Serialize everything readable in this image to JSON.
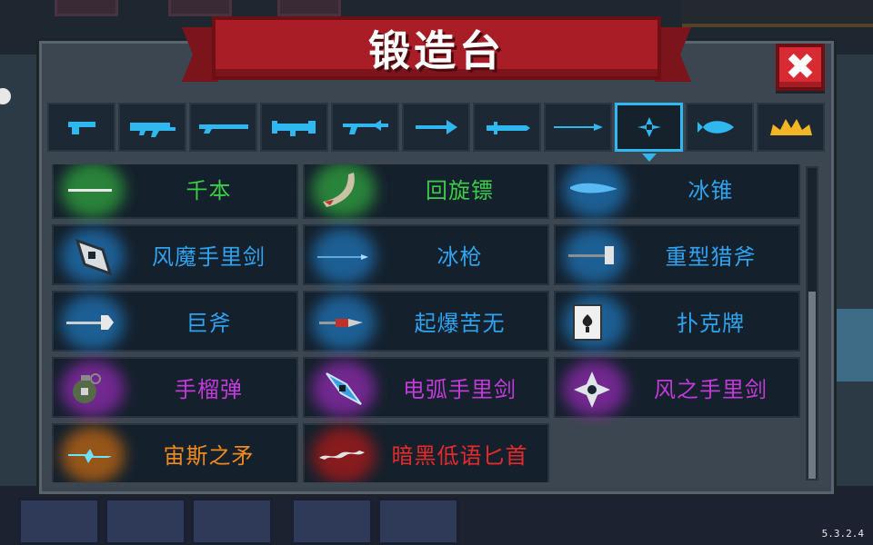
{
  "title": "锻造台",
  "version": "5.3.2.4",
  "colors": {
    "tab_icon": "#2fb8f0",
    "tab_icon_special": "#f2b526",
    "rarity_green": "#3ccc48",
    "rarity_blue": "#2fa3f0",
    "rarity_purple": "#c23ad8",
    "rarity_orange": "#f08a1e",
    "rarity_red": "#e62a2a",
    "banner": "#a91d26",
    "close": "#d72a32"
  },
  "tabs": [
    {
      "icon": "pistol-icon",
      "active": false
    },
    {
      "icon": "rifle-icon",
      "active": false
    },
    {
      "icon": "shotgun-icon",
      "active": false
    },
    {
      "icon": "launcher-icon",
      "active": false
    },
    {
      "icon": "laser-gun-icon",
      "active": false
    },
    {
      "icon": "bow-icon",
      "active": false
    },
    {
      "icon": "sword-icon",
      "active": false
    },
    {
      "icon": "spear-icon",
      "active": false
    },
    {
      "icon": "shuriken-icon",
      "active": true
    },
    {
      "icon": "fish-icon",
      "active": false
    },
    {
      "icon": "crown-icon",
      "active": false
    }
  ],
  "weapons": [
    {
      "name": "千本",
      "rarity": "green",
      "icon": "needle-icon"
    },
    {
      "name": "回旋镖",
      "rarity": "green",
      "icon": "boomerang-icon"
    },
    {
      "name": "冰锥",
      "rarity": "blue",
      "icon": "icicle-icon"
    },
    {
      "name": "风魔手里剑",
      "rarity": "blue",
      "icon": "fuma-shuriken-icon"
    },
    {
      "name": "冰枪",
      "rarity": "blue",
      "icon": "ice-spear-icon"
    },
    {
      "name": "重型猎斧",
      "rarity": "blue",
      "icon": "hunting-axe-icon"
    },
    {
      "name": "巨斧",
      "rarity": "blue",
      "icon": "great-axe-icon"
    },
    {
      "name": "起爆苦无",
      "rarity": "blue",
      "icon": "explosive-kunai-icon"
    },
    {
      "name": "扑克牌",
      "rarity": "blue",
      "icon": "poker-card-icon"
    },
    {
      "name": "手榴弹",
      "rarity": "purple",
      "icon": "grenade-icon"
    },
    {
      "name": "电弧手里剑",
      "rarity": "purple",
      "icon": "arc-shuriken-icon"
    },
    {
      "name": "风之手里剑",
      "rarity": "purple",
      "icon": "wind-shuriken-icon"
    },
    {
      "name": "宙斯之矛",
      "rarity": "orange",
      "icon": "zeus-spear-icon"
    },
    {
      "name": "暗黑低语匕首",
      "rarity": "red",
      "icon": "dark-whisper-dagger-icon"
    }
  ],
  "scrollbar": {
    "position": 0.42
  }
}
